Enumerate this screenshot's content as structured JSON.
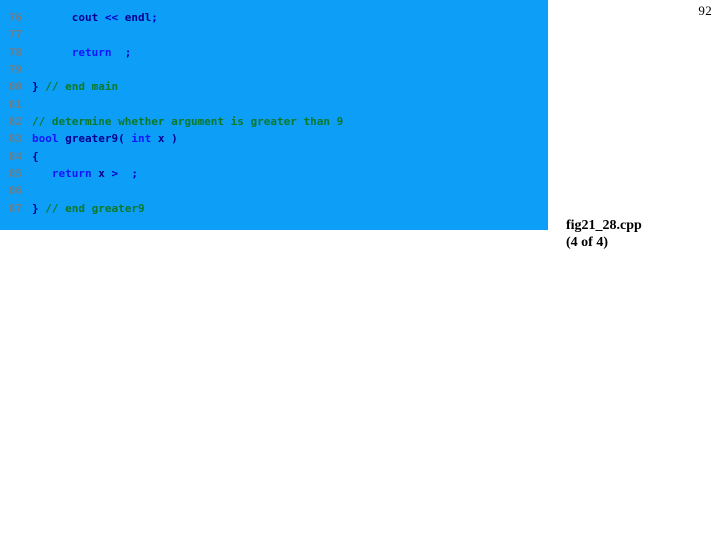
{
  "page": {
    "number": "92",
    "background_color": "#ffffff"
  },
  "code_panel": {
    "background_color": "#0d9ef7",
    "line_number_color": "#6e7d86",
    "colors": {
      "plain": "#00008f",
      "keyword": "#1414ff",
      "comment": "#0a7a28",
      "operator": "#0000c8"
    },
    "lines": [
      {
        "number": "76",
        "tokens": [
          {
            "text": "      ",
            "type": "plain"
          },
          {
            "text": "cout",
            "type": "plain"
          },
          {
            "text": " ",
            "type": "plain"
          },
          {
            "text": "<<",
            "type": "operator"
          },
          {
            "text": " ",
            "type": "plain"
          },
          {
            "text": "endl",
            "type": "plain"
          },
          {
            "text": ";",
            "type": "operator"
          }
        ]
      },
      {
        "number": "77",
        "tokens": []
      },
      {
        "number": "78",
        "tokens": [
          {
            "text": "      ",
            "type": "plain"
          },
          {
            "text": "return",
            "type": "keyword"
          },
          {
            "text": "  ",
            "type": "plain"
          },
          {
            "text": ";",
            "type": "operator"
          }
        ]
      },
      {
        "number": "79",
        "tokens": []
      },
      {
        "number": "80",
        "tokens": [
          {
            "text": "}",
            "type": "plain"
          },
          {
            "text": " ",
            "type": "plain"
          },
          {
            "text": "// end main",
            "type": "comment"
          }
        ]
      },
      {
        "number": "81",
        "tokens": []
      },
      {
        "number": "82",
        "tokens": [
          {
            "text": "// determine whether argument is greater than 9",
            "type": "comment"
          }
        ]
      },
      {
        "number": "83",
        "tokens": [
          {
            "text": "bool",
            "type": "keyword"
          },
          {
            "text": " ",
            "type": "plain"
          },
          {
            "text": "greater9(",
            "type": "plain"
          },
          {
            "text": " ",
            "type": "plain"
          },
          {
            "text": "int",
            "type": "keyword"
          },
          {
            "text": " ",
            "type": "plain"
          },
          {
            "text": "x",
            "type": "plain"
          },
          {
            "text": " )",
            "type": "plain"
          }
        ]
      },
      {
        "number": "84",
        "tokens": [
          {
            "text": "{",
            "type": "plain"
          }
        ]
      },
      {
        "number": "85",
        "tokens": [
          {
            "text": "   ",
            "type": "plain"
          },
          {
            "text": "return",
            "type": "keyword"
          },
          {
            "text": " ",
            "type": "plain"
          },
          {
            "text": "x",
            "type": "plain"
          },
          {
            "text": " ",
            "type": "plain"
          },
          {
            "text": ">",
            "type": "operator"
          },
          {
            "text": "  ",
            "type": "plain"
          },
          {
            "text": ";",
            "type": "operator"
          }
        ]
      },
      {
        "number": "86",
        "tokens": []
      },
      {
        "number": "87",
        "tokens": [
          {
            "text": "}",
            "type": "plain"
          },
          {
            "text": " ",
            "type": "plain"
          },
          {
            "text": "// end greater9",
            "type": "comment"
          }
        ]
      }
    ]
  },
  "caption": {
    "filename": "fig21_28.cpp",
    "part": "(4 of 4)"
  }
}
